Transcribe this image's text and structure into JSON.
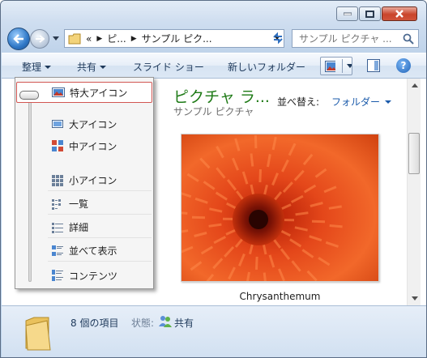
{
  "window": {
    "minimize_icon": "minimize-icon",
    "maximize_icon": "maximize-icon",
    "close_icon": "close-icon"
  },
  "address_bar": {
    "overflow": "«",
    "crumbs": [
      "ピ...",
      "サンプル ピク..."
    ]
  },
  "search": {
    "placeholder": "サンプル ピクチャ ..."
  },
  "toolbar": {
    "organize": "整理",
    "share": "共有",
    "slideshow": "スライド ショー",
    "new_folder": "新しいフォルダー",
    "help": "?"
  },
  "library": {
    "title": "ピクチャ ラ...",
    "subtitle": "サンプル ピクチャ",
    "arrange_label": "並べ替え:",
    "arrange_value": "フォルダー"
  },
  "file": {
    "name": "Chrysanthemum"
  },
  "view_menu": {
    "slider_level": "特大アイコン",
    "items": [
      {
        "label": "特大アイコン",
        "icon": "extra-large-icons-icon"
      },
      {
        "label": "大アイコン",
        "icon": "large-icons-icon"
      },
      {
        "label": "中アイコン",
        "icon": "medium-icons-icon"
      },
      {
        "label": "小アイコン",
        "icon": "small-icons-icon"
      },
      {
        "label": "一覧",
        "icon": "list-view-icon"
      },
      {
        "label": "詳細",
        "icon": "details-view-icon"
      },
      {
        "label": "並べて表示",
        "icon": "tiles-view-icon"
      },
      {
        "label": "コンテンツ",
        "icon": "content-view-icon"
      }
    ]
  },
  "status": {
    "count": "8 個の項目",
    "state_label": "状態:",
    "state_value": "共有"
  },
  "colors": {
    "accent_green": "#1e7a16",
    "link_blue": "#1b5bab",
    "selection_border": "#d25652"
  }
}
